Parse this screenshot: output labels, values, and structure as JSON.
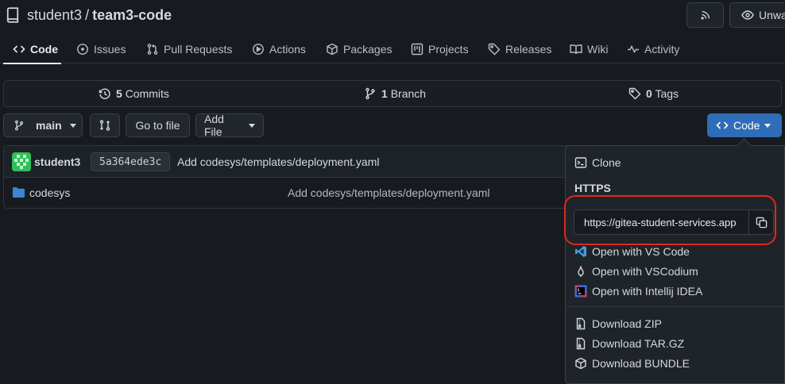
{
  "repo": {
    "owner": "student3",
    "separator": "/",
    "name": "team3-code"
  },
  "header": {
    "watch_label": "Unwat"
  },
  "tabs": [
    {
      "label": "Code"
    },
    {
      "label": "Issues"
    },
    {
      "label": "Pull Requests"
    },
    {
      "label": "Actions"
    },
    {
      "label": "Packages"
    },
    {
      "label": "Projects"
    },
    {
      "label": "Releases"
    },
    {
      "label": "Wiki"
    },
    {
      "label": "Activity"
    }
  ],
  "stats": {
    "commits_count": "5",
    "commits_label": "Commits",
    "branches_count": "1",
    "branches_label": "Branch",
    "tags_count": "0",
    "tags_label": "Tags"
  },
  "toolbar": {
    "branch": "main",
    "go_to_file": "Go to file",
    "add_file": "Add File",
    "code_button": "Code"
  },
  "last_commit": {
    "author": "student3",
    "sha": "5a364ede3c",
    "message": "Add codesys/templates/deployment.yaml"
  },
  "files": [
    {
      "name": "codesys",
      "message": "Add codesys/templates/deployment.yaml"
    }
  ],
  "clone_menu": {
    "clone_label": "Clone",
    "protocol": "HTTPS",
    "url": "https://gitea-student-services.app",
    "open_vscode": "Open with VS Code",
    "open_vscodium": "Open with VSCodium",
    "open_intellij": "Open with Intellij IDEA",
    "download_zip": "Download ZIP",
    "download_targz": "Download TAR.GZ",
    "download_bundle": "Download BUNDLE"
  },
  "colors": {
    "accent": "#2f6db8",
    "highlight": "#e0281b",
    "background": "#171b20"
  }
}
